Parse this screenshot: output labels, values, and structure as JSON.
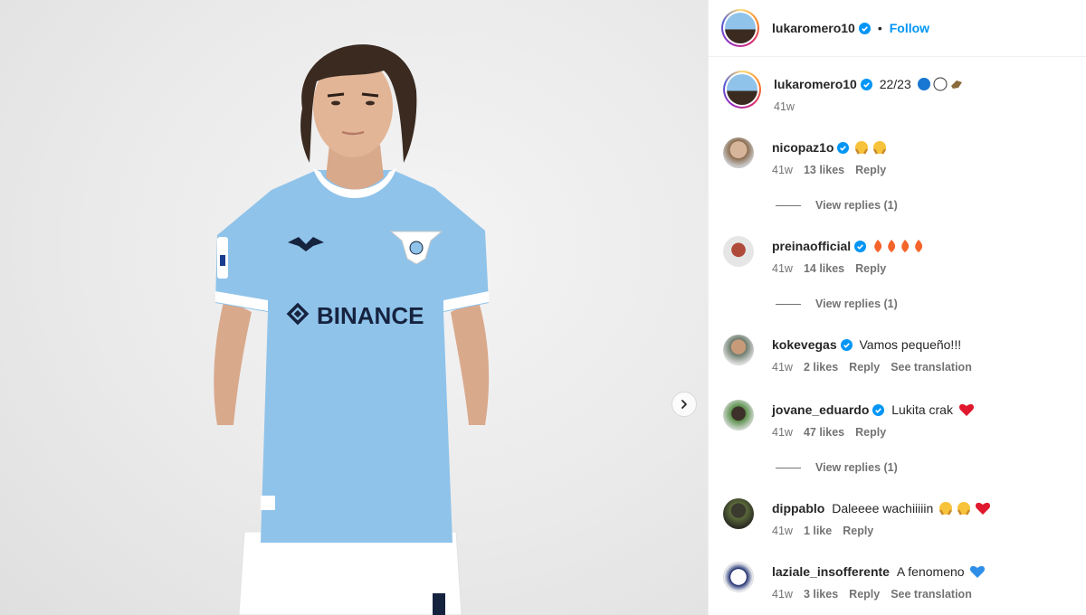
{
  "post": {
    "author": "lukaromero10",
    "follow_label": "Follow",
    "separator": "•",
    "caption": "22/23",
    "caption_time": "41w",
    "jersey_sponsor": "BINANCE"
  },
  "comments": [
    {
      "user": "nicopaz1o",
      "verified": true,
      "text": "",
      "emoji": [
        "face-holding-tears",
        "face-holding-tears"
      ],
      "time": "41w",
      "likes": "13 likes",
      "reply": "Reply",
      "translate": "",
      "replies": "View replies (1)"
    },
    {
      "user": "preinaofficial",
      "verified": true,
      "text": "",
      "emoji": [
        "fire",
        "fire",
        "fire",
        "fire"
      ],
      "time": "41w",
      "likes": "14 likes",
      "reply": "Reply",
      "translate": "",
      "replies": "View replies (1)"
    },
    {
      "user": "kokevegas",
      "verified": true,
      "text": "Vamos pequeño!!!",
      "emoji": [],
      "time": "41w",
      "likes": "2 likes",
      "reply": "Reply",
      "translate": "See translation",
      "replies": ""
    },
    {
      "user": "jovane_eduardo",
      "verified": true,
      "text": "Lukita crak",
      "emoji": [
        "red-heart"
      ],
      "time": "41w",
      "likes": "47 likes",
      "reply": "Reply",
      "translate": "",
      "replies": "View replies (1)"
    },
    {
      "user": "dippablo",
      "verified": false,
      "text": "Daleeee wachiiiiin",
      "emoji": [
        "face-holding-tears",
        "face-holding-tears",
        "red-heart"
      ],
      "time": "41w",
      "likes": "1 like",
      "reply": "Reply",
      "translate": "",
      "replies": ""
    },
    {
      "user": "laziale_insofferente",
      "verified": false,
      "text": "A fenomeno",
      "emoji": [
        "blue-heart"
      ],
      "time": "41w",
      "likes": "3 likes",
      "reply": "Reply",
      "translate": "See translation",
      "replies": ""
    }
  ],
  "colors": {
    "link": "#0095f6",
    "verified": "#0095f6",
    "jersey": "#8fc3ea",
    "muted": "#737373"
  }
}
